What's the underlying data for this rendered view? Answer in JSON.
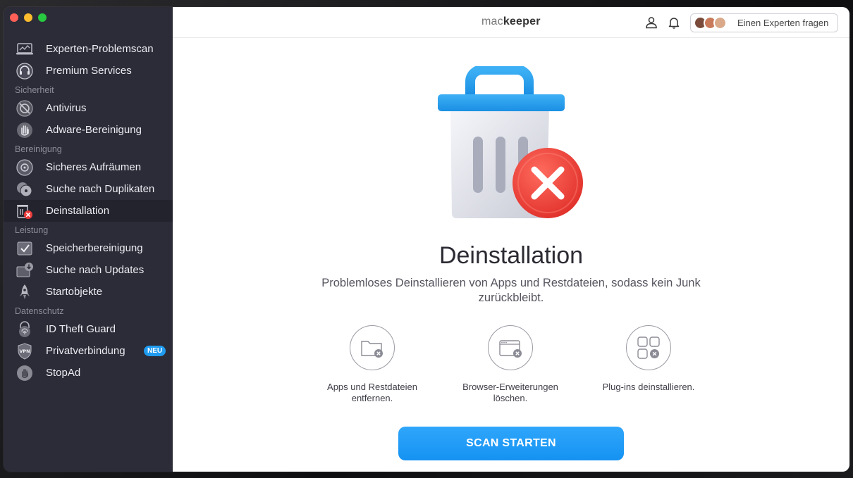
{
  "app": {
    "logo_mac": "mac",
    "logo_keeper": "keeper"
  },
  "header": {
    "expert_label": "Einen Experten fragen"
  },
  "sidebar": {
    "items": [
      {
        "label": "Experten-Problemscan",
        "icon": "laptop-scan-icon"
      },
      {
        "label": "Premium Services",
        "icon": "headset-icon"
      },
      {
        "section": "Sicherheit"
      },
      {
        "label": "Antivirus",
        "icon": "antivirus-icon"
      },
      {
        "label": "Adware-Bereinigung",
        "icon": "hand-stop-icon"
      },
      {
        "section": "Bereinigung"
      },
      {
        "label": "Sicheres Aufräumen",
        "icon": "disk-clean-icon"
      },
      {
        "label": "Suche nach Duplikaten",
        "icon": "duplicates-icon"
      },
      {
        "label": "Deinstallation",
        "icon": "uninstall-icon",
        "active": true
      },
      {
        "section": "Leistung"
      },
      {
        "label": "Speicherbereinigung",
        "icon": "memory-icon"
      },
      {
        "label": "Suche nach Updates",
        "icon": "update-icon"
      },
      {
        "label": "Startobjekte",
        "icon": "rocket-icon"
      },
      {
        "section": "Datenschutz"
      },
      {
        "label": "ID Theft Guard",
        "icon": "fingerprint-icon"
      },
      {
        "label": "Privatverbindung",
        "icon": "vpn-shield-icon",
        "badge": "NEU"
      },
      {
        "label": "StopAd",
        "icon": "stopad-icon"
      }
    ]
  },
  "main": {
    "title": "Deinstallation",
    "subtitle": "Problemloses Deinstallieren von Apps und Restdateien, sodass kein Junk zurückbleibt.",
    "features": [
      {
        "label": "Apps und Restdateien entfernen.",
        "icon": "folder-remove-icon"
      },
      {
        "label": "Browser-Erweiterungen löschen.",
        "icon": "browser-remove-icon"
      },
      {
        "label": "Plug-ins deinstallieren.",
        "icon": "plugins-remove-icon"
      }
    ],
    "scan_button": "SCAN STARTEN"
  },
  "colors": {
    "sidebar_bg": "#2c2c38",
    "accent": "#1f9bf0",
    "danger": "#ee3b3b"
  }
}
